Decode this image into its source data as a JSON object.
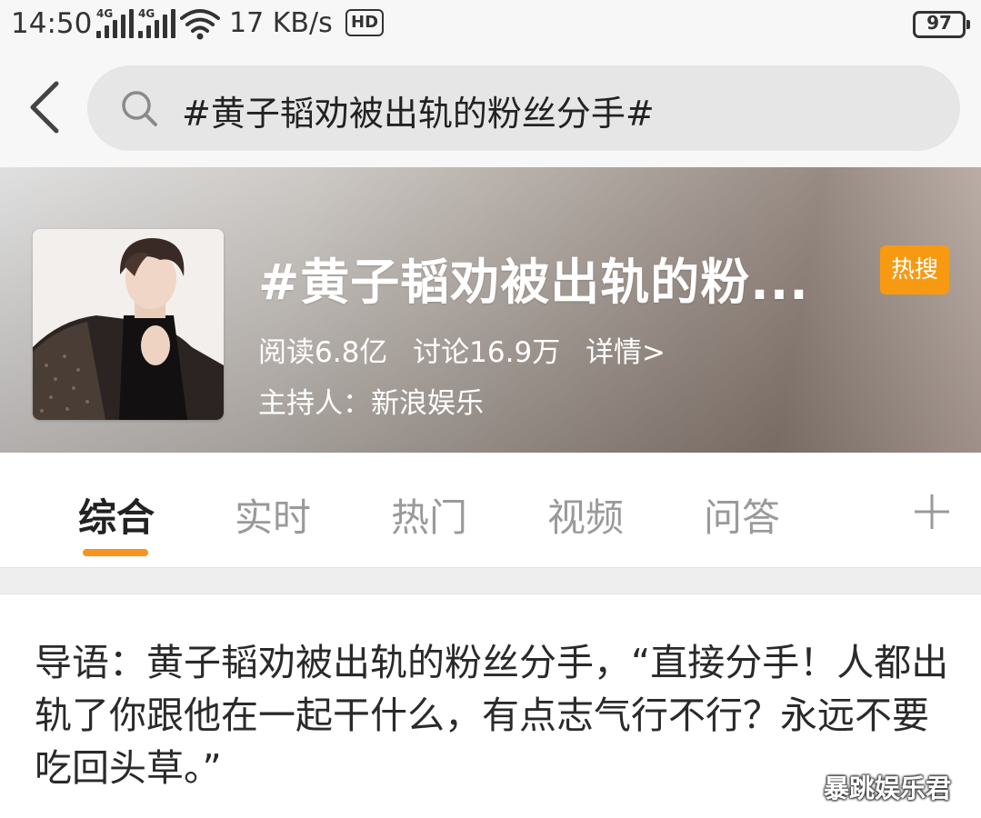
{
  "status_bar": {
    "time": "14:50",
    "signal_label_1": "4G",
    "signal_label_2": "4G",
    "network_speed": "17 KB/s",
    "hd_label": "HD",
    "battery": "97"
  },
  "search": {
    "query": "#黄子韬劝被出轨的粉丝分手#"
  },
  "topic": {
    "title": "#黄子韬劝被出轨的粉...",
    "badge": "热搜",
    "reads": "阅读6.8亿",
    "discussions": "讨论16.9万",
    "details": "详情>",
    "host": "主持人：新浪娱乐",
    "accent_color": "#f79a12"
  },
  "tabs": [
    {
      "label": "综合",
      "active": true
    },
    {
      "label": "实时",
      "active": false
    },
    {
      "label": "热门",
      "active": false
    },
    {
      "label": "视频",
      "active": false
    },
    {
      "label": "问答",
      "active": false
    }
  ],
  "tab_indicator_color": "#f7941d",
  "intro": {
    "text": "导语：黄子韬劝被出轨的粉丝分手，“直接分手！人都出轨了你跟他在一起干什么，有点志气行不行？永远不要吃回头草。”"
  },
  "watermark": "暴跳娱乐君",
  "icons": [
    "back-arrow-icon",
    "search-icon",
    "plus-icon",
    "wifi-icon",
    "signal-icon",
    "battery-icon"
  ]
}
